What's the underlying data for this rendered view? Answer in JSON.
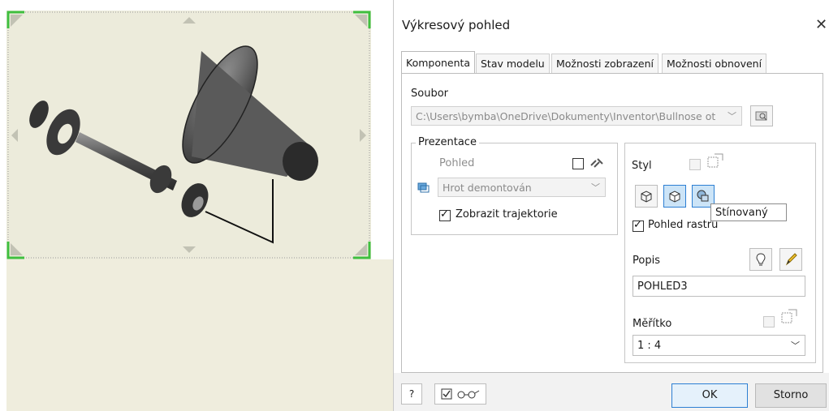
{
  "dialog": {
    "title": "Výkresový pohled",
    "close_glyph": "✕",
    "tabs": [
      "Komponenta",
      "Stav modelu",
      "Možnosti zobrazení",
      "Možnosti obnovení"
    ],
    "active_tab": "Komponenta"
  },
  "file": {
    "label": "Soubor",
    "path": "C:\\Users\\bymba\\OneDrive\\Dokumenty\\Inventor\\Bullnose ot",
    "browse_icon": "folder-search-icon"
  },
  "presentation": {
    "group_label": "Prezentace",
    "view_label": "Pohled",
    "view_value": "Hrot demontován",
    "show_trails_label": "Zobrazit trajektorie",
    "show_trails_checked": true
  },
  "style": {
    "label": "Styl",
    "buttons": [
      "hidden-line-icon",
      "hidden-line-removed-icon",
      "shaded-icon"
    ],
    "selected": "shaded-icon",
    "raster_label": "Pohled rastru",
    "raster_checked": true,
    "tooltip": "Stínovaný"
  },
  "label_section": {
    "label": "Popis",
    "value": "POHLED3"
  },
  "scale": {
    "label": "Měřítko",
    "value": "1 : 4"
  },
  "footer": {
    "ok": "OK",
    "cancel": "Storno",
    "help_glyph": "?"
  },
  "colors": {
    "accent": "#2d7fd3",
    "preview_bg": "#ecebdb",
    "frame_green": "#3fbf3f"
  }
}
